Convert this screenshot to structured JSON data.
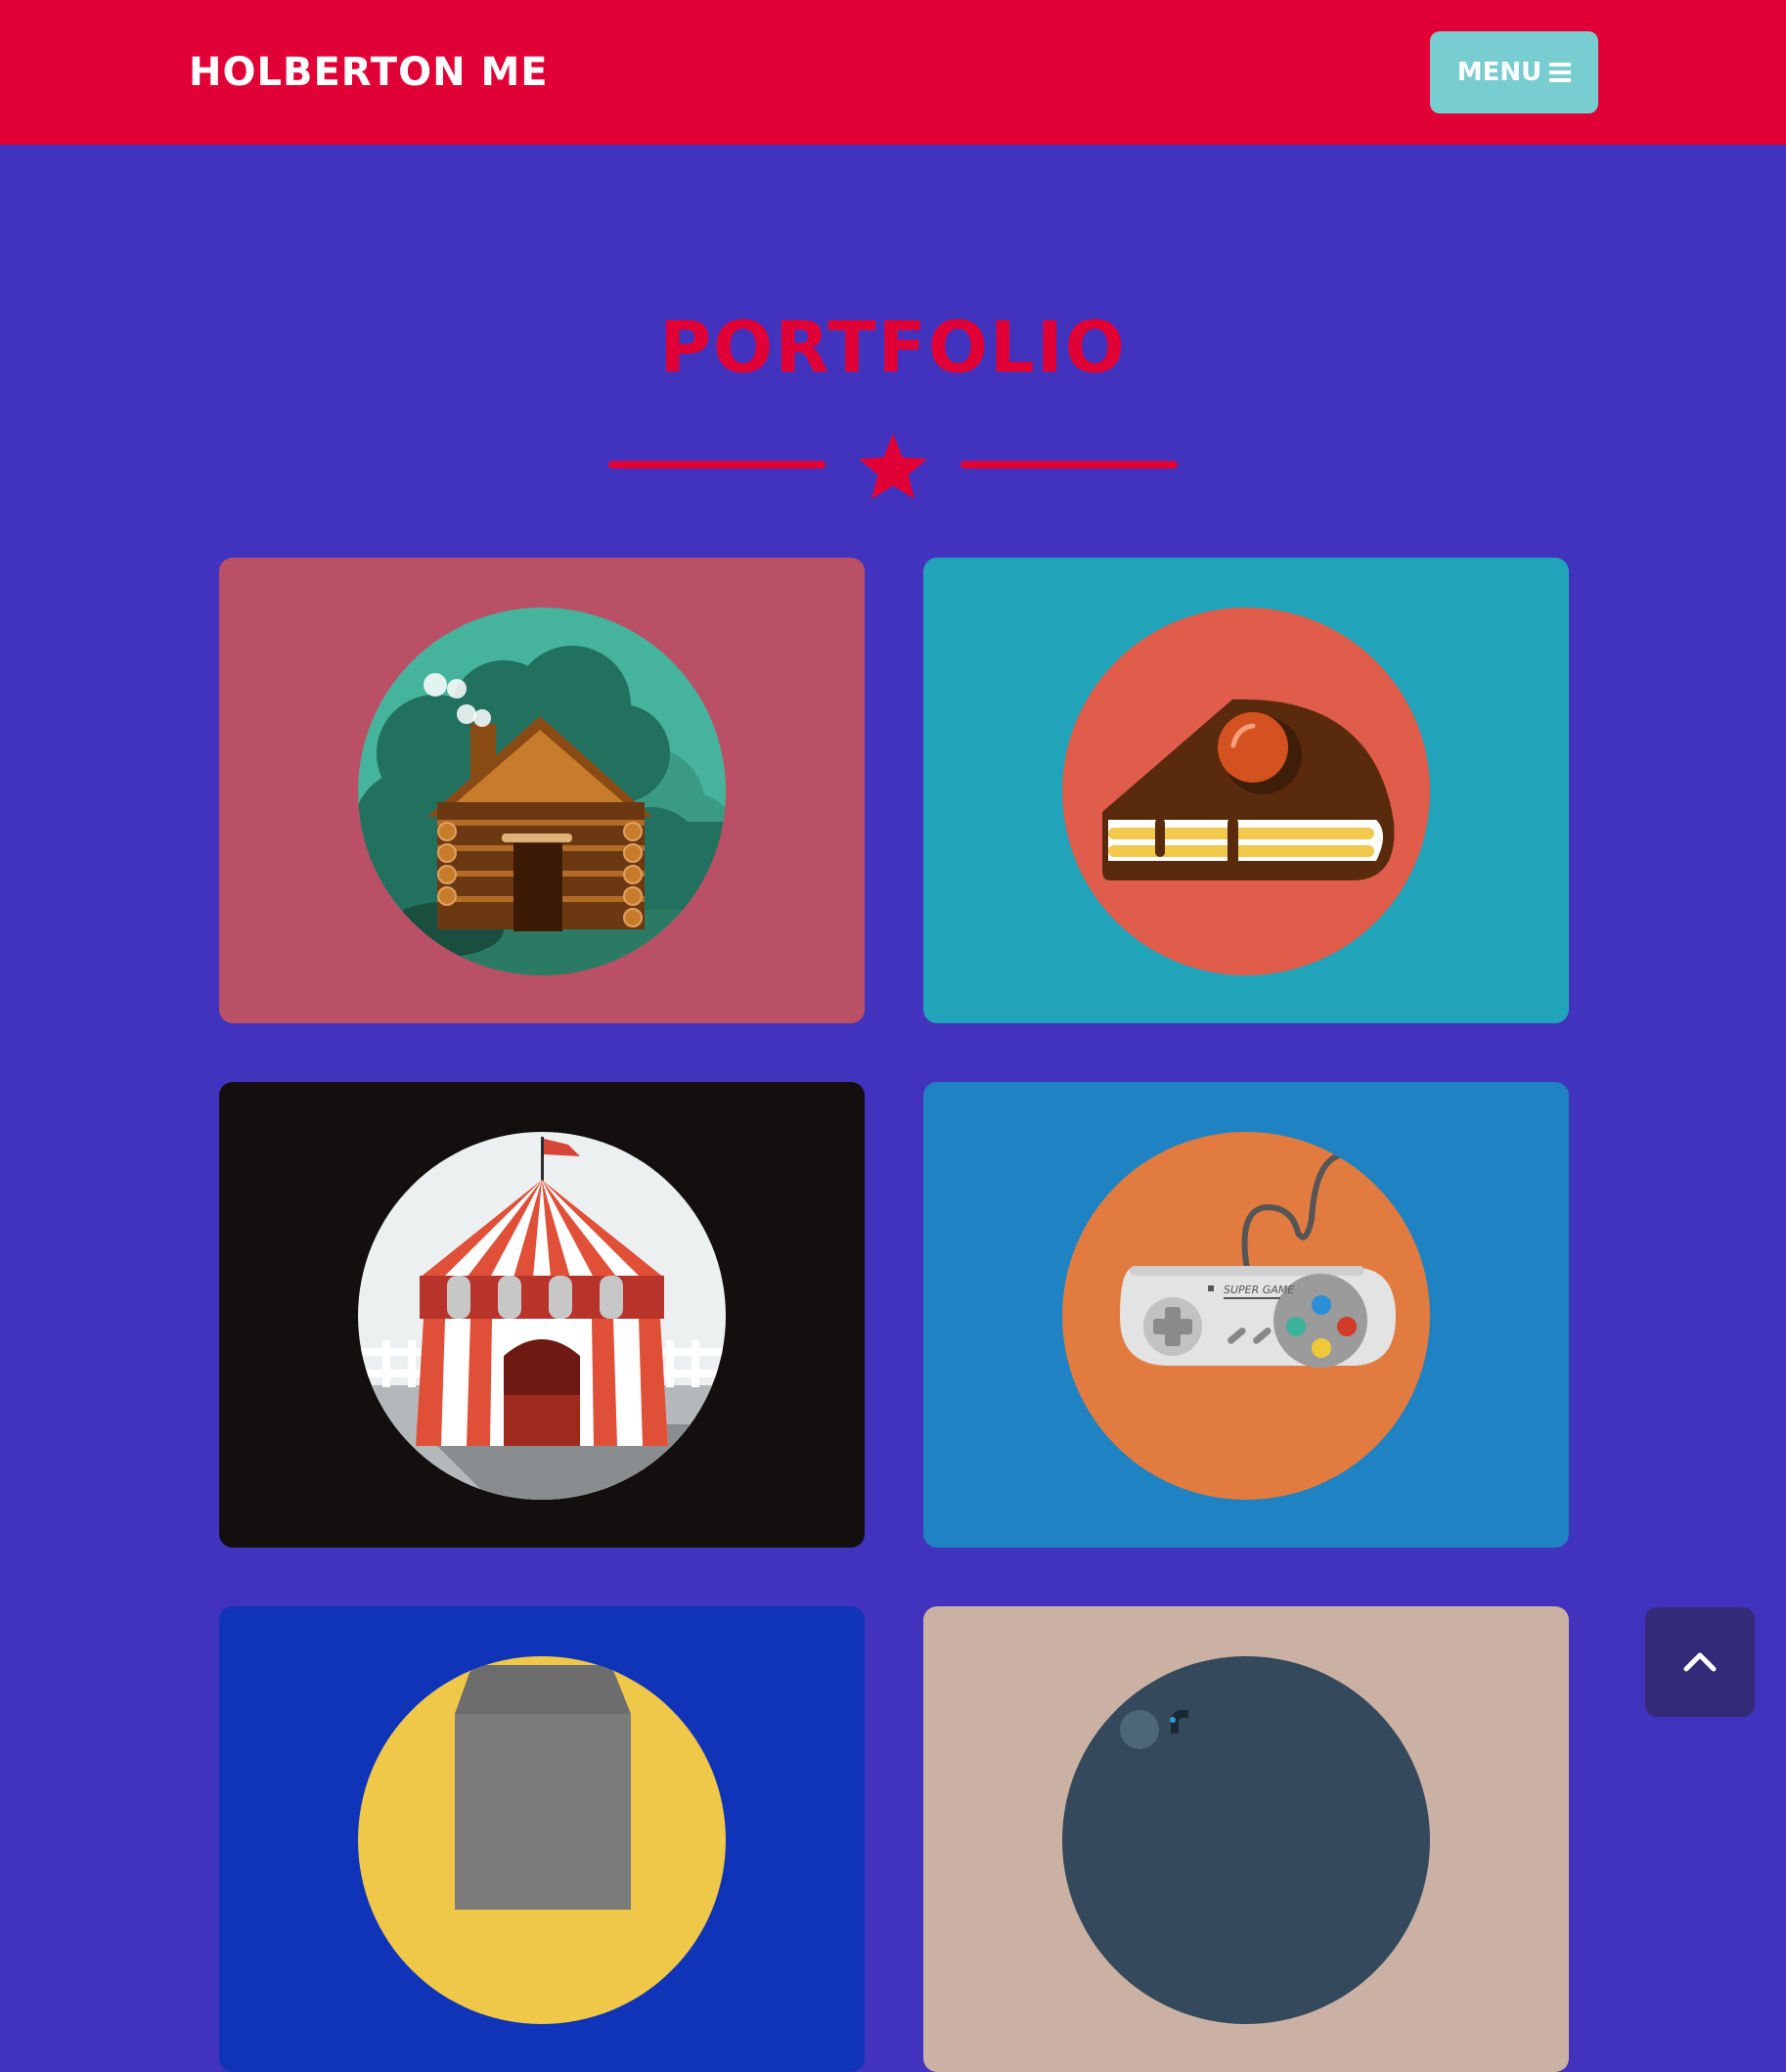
{
  "navbar": {
    "brand": "HOLBERTON ME",
    "menu_label": "MENU",
    "menu_icon": "bars-icon"
  },
  "section": {
    "title": "PORTFOLIO",
    "divider_icon": "star-icon"
  },
  "portfolio": {
    "items": [
      {
        "name": "cabin",
        "bg": "#b95066",
        "circle": "#46b39c"
      },
      {
        "name": "cake",
        "bg": "#21a4b9",
        "circle": "#e05c4b"
      },
      {
        "name": "circus",
        "bg": "#130f0e",
        "circle": "#ecf0f1"
      },
      {
        "name": "game",
        "bg": "#1f82c3",
        "circle": "#e17b3f",
        "label": "SUPER GAME"
      },
      {
        "name": "safe",
        "bg": "#1034b8",
        "circle": "#efc749"
      },
      {
        "name": "submarine",
        "bg": "#cbb1a3",
        "circle": "#344a5c"
      }
    ]
  },
  "colors": {
    "background": "#4133bd",
    "navbar": "#e10036",
    "accent": "#e10036",
    "menu_button": "#78cdd1",
    "back_to_top": "#332b78"
  },
  "back_to_top_icon": "chevron-up-icon"
}
